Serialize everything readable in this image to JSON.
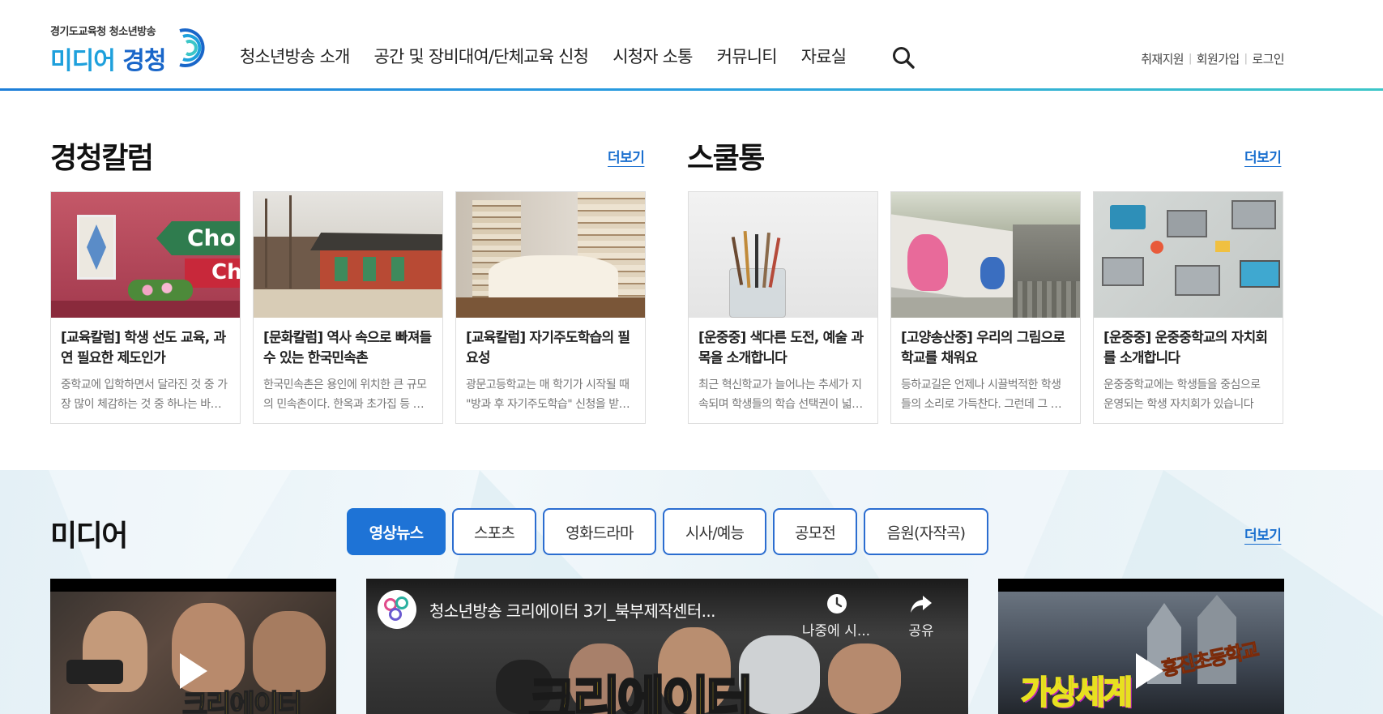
{
  "header": {
    "logo_sub": "경기도교육청 청소년방송",
    "logo_main_a": "미디어",
    "logo_main_b": "경청",
    "nav": [
      "청소년방송 소개",
      "공간 및 장비대여/단체교육 신청",
      "시청자 소통",
      "커뮤니티",
      "자료실"
    ],
    "util": [
      "취재지원",
      "회원가입",
      "로그인"
    ],
    "search_icon": "search-icon"
  },
  "column": {
    "title": "경청칼럼",
    "more": "더보기",
    "cards": [
      {
        "title": "[교육칼럼] 학생 선도 교육, 과연 필요한 제도인가",
        "desc": "중학교에 입학하면서 달라진 것 중 가장 많이 체감하는 것 중 하나는 바로 학생 선도"
      },
      {
        "title": "[문화칼럼] 역사 속으로 빠져들 수 있는 한국민속촌",
        "desc": "한국민속촌은 용인에 위치한 큰 규모의 민속촌이다. 한옥과 초가집 등 옛 모습"
      },
      {
        "title": "[교육칼럼] 자기주도학습의 필요성",
        "desc": "광문고등학교는 매 학기가 시작될 때 \"방과 후 자기주도학습\" 신청을 받는다"
      }
    ]
  },
  "schooltong": {
    "title": "스쿨통",
    "more": "더보기",
    "cards": [
      {
        "title": "[운중중] 색다른 도전, 예술 과목을 소개합니다",
        "desc": "최근 혁신학교가 늘어나는 추세가 지속되며 학생들의 학습 선택권이 넓어지고"
      },
      {
        "title": "[고양송산중] 우리의 그림으로 학교를 채워요",
        "desc": "등하교길은 언제나 시끌벅적한 학생들의 소리로 가득찬다. 그런데 그 길에"
      },
      {
        "title": "[운중중] 운중중학교의 자치회를 소개합니다",
        "desc": "운중중학교에는 학생들을 중심으로 운영되는 학생 자치회가 있습니다"
      }
    ]
  },
  "media": {
    "title": "미디어",
    "more": "더보기",
    "tabs": [
      "영상뉴스",
      "스포츠",
      "영화드라마",
      "시사/예능",
      "공모전",
      "음원(자작곡)"
    ],
    "active_tab": 0,
    "video_center": {
      "title": "청소년방송 크리에이터 3기_북부제작센터...",
      "watch_later": "나중에 시...",
      "share": "공유",
      "caption": "크리에이터"
    },
    "video_left": {
      "caption": "크리에이터"
    },
    "video_right": {
      "caption": "가상세계",
      "sub": "홍진초등학교"
    }
  },
  "colors": {
    "brand_blue": "#1e73d6",
    "link_blue": "#1a6fcf",
    "band_bg": "#eaf3f8"
  }
}
